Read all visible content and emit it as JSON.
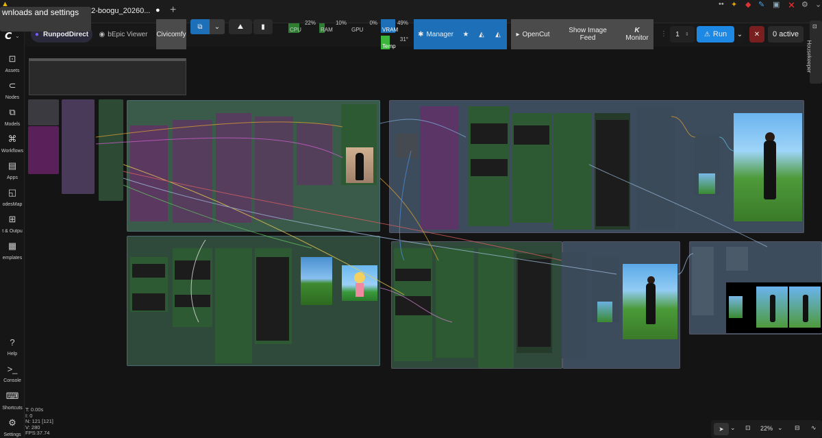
{
  "tab": {
    "title": "a2-boogu_20260...",
    "tooltip": "wnloads and settings",
    "new_tab": "+",
    "modified_dot": "●"
  },
  "toolbar": {
    "profile": "RunpodDirect",
    "viewer": "bEpic Viewer",
    "civicomfy": "Civicomfy",
    "cpu_label": "CPU",
    "cpu_value": "22%",
    "ram_label": "RAM",
    "ram_value": "10%",
    "gpu_label": "GPU",
    "gpu_value": "0%",
    "vram_label": "VRAM",
    "vram_value": "49%",
    "temp_label": "Temp",
    "temp_value": "31°",
    "manager": "Manager",
    "opencut": "OpenCut",
    "show_image_feed_line1": "Show Image",
    "show_image_feed_line2": "Feed",
    "monitor": "Monitor",
    "batch_count": "1",
    "run": "Run",
    "active": "0 active",
    "housekeeper": "Housekeeper"
  },
  "sidebar": {
    "items": [
      {
        "label": "Assets",
        "icon": "assets-icon"
      },
      {
        "label": "Nodes",
        "icon": "nodes-icon"
      },
      {
        "label": "Models",
        "icon": "models-icon"
      },
      {
        "label": "Workflows",
        "icon": "workflows-icon"
      },
      {
        "label": "Apps",
        "icon": "apps-icon"
      },
      {
        "label": "odesMap",
        "icon": "nodesmap-icon"
      },
      {
        "label": "t & Outpu",
        "icon": "media-icon"
      },
      {
        "label": "emplates",
        "icon": "templates-icon"
      },
      {
        "label": "Help",
        "icon": "help-icon"
      },
      {
        "label": "Console",
        "icon": "console-icon"
      },
      {
        "label": "Shortcuts",
        "icon": "keyboard-icon"
      },
      {
        "label": "Settings",
        "icon": "gear-icon"
      }
    ]
  },
  "stats": {
    "t": "T: 0.00s",
    "i": "I: 0",
    "n": "N: 121 [121]",
    "v": "V: 280",
    "fps": "FPS:37.74"
  },
  "bottom": {
    "zoom": "22%"
  },
  "colors": {
    "accent": "#2196f3",
    "run": "#1e88e5",
    "manager": "#1d6fb8",
    "node_green": "#2e5a33",
    "group_green": "#3b5e45",
    "group_blue": "#3c4c5c",
    "purple": "#6a2a6a"
  }
}
